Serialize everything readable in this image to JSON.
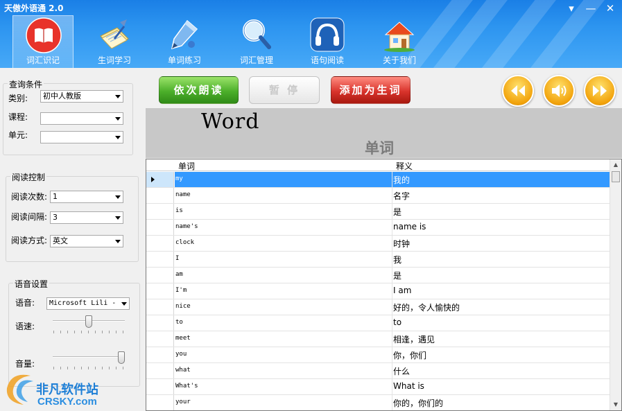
{
  "app": {
    "title": "天傲外语通 2.0"
  },
  "window": {
    "menu_glyph": "▾",
    "minimize_glyph": "—",
    "close_glyph": "✕"
  },
  "nav": [
    {
      "label": "词汇识记",
      "icon": "book-icon",
      "active": true
    },
    {
      "label": "生词学习",
      "icon": "notebook-pen-icon",
      "active": false
    },
    {
      "label": "单词练习",
      "icon": "pencil-icon",
      "active": false
    },
    {
      "label": "词汇管理",
      "icon": "magnifier-icon",
      "active": false
    },
    {
      "label": "语句阅读",
      "icon": "headphones-icon",
      "active": false
    },
    {
      "label": "关于我们",
      "icon": "house-icon",
      "active": false
    }
  ],
  "query": {
    "title": "查询条件",
    "category_label": "类别:",
    "category_value": "初中人教版",
    "course_label": "课程:",
    "course_value": "",
    "unit_label": "单元:",
    "unit_value": ""
  },
  "reading": {
    "title": "阅读控制",
    "times_label": "阅读次数:",
    "times_value": "1",
    "interval_label": "阅读间隔:",
    "interval_value": "3",
    "mode_label": "阅读方式:",
    "mode_value": "英文"
  },
  "voice": {
    "title": "语音设置",
    "voice_label": "语音:",
    "voice_value": "Microsoft Lili -",
    "speed_label": "语速:",
    "speed_level": 0.5,
    "volume_label": "音量:",
    "volume_level": 1.0
  },
  "actions": {
    "read_in_order": "依次朗读",
    "pause": "暂 停",
    "add_new_word": "添加为生词"
  },
  "display": {
    "word": "Word",
    "meaning": "单词"
  },
  "grid": {
    "headers": {
      "word": "单词",
      "meaning": "释义"
    },
    "rows": [
      {
        "word": "my",
        "meaning": "我的",
        "selected": true
      },
      {
        "word": "name",
        "meaning": "名字"
      },
      {
        "word": "is",
        "meaning": "是"
      },
      {
        "word": "name's",
        "meaning": "name is"
      },
      {
        "word": "clock",
        "meaning": "时钟"
      },
      {
        "word": "I",
        "meaning": "我"
      },
      {
        "word": "am",
        "meaning": "是"
      },
      {
        "word": "I'm",
        "meaning": "I am"
      },
      {
        "word": "nice",
        "meaning": "好的，令人愉快的"
      },
      {
        "word": "to",
        "meaning": "to"
      },
      {
        "word": "meet",
        "meaning": "相逢，遇见"
      },
      {
        "word": "you",
        "meaning": "你，你们"
      },
      {
        "word": "what",
        "meaning": "什么"
      },
      {
        "word": "What's",
        "meaning": "What is"
      },
      {
        "word": "your",
        "meaning": "你的，你们的"
      }
    ]
  },
  "watermark": {
    "cn": "非凡软件站",
    "en": "CRSKY.com"
  },
  "colors": {
    "accent": "#3399ff",
    "toolbar": "#2d95f0",
    "green_btn": "#4caf2a",
    "red_btn": "#d9342c",
    "orange_btn": "#f2a30c"
  }
}
